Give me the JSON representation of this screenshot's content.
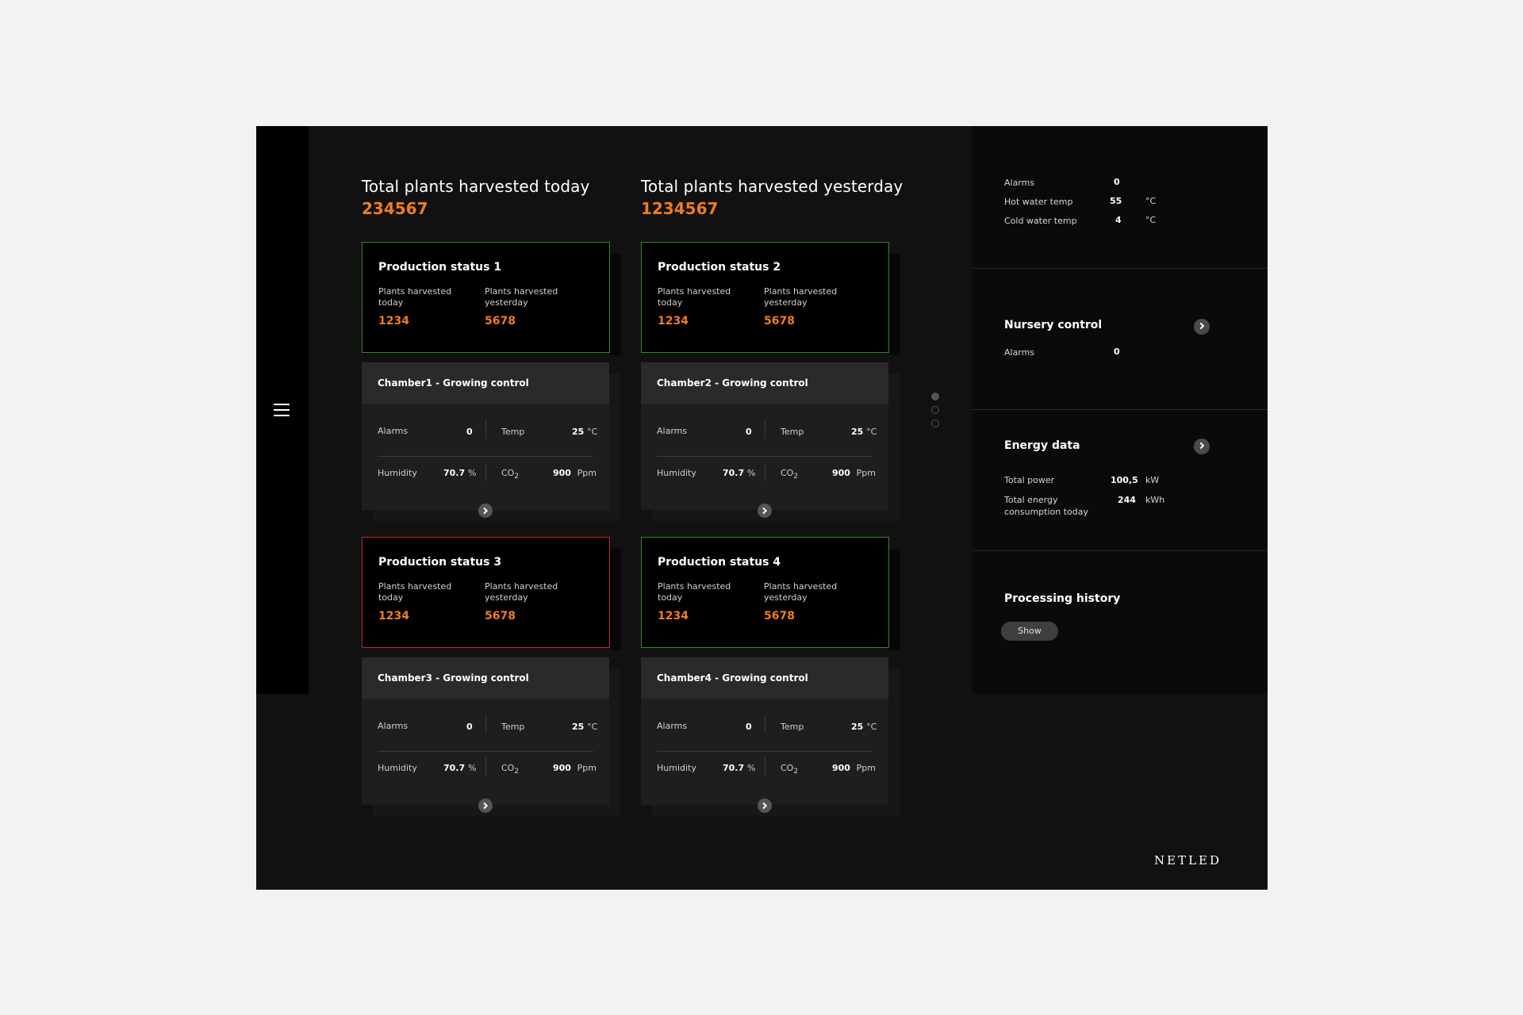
{
  "menu": {
    "icon": "hamburger-icon"
  },
  "totals": [
    {
      "label": "Total plants harvested today",
      "value": "234567"
    },
    {
      "label": "Total plants harvested yesterday",
      "value": "1234567"
    }
  ],
  "production": [
    {
      "title": "Production status 1",
      "today_label": "Plants harvested today",
      "yesterday_label": "Plants harvested yesterday",
      "today": "1234",
      "yesterday": "5678",
      "status_color": "#2f8a24"
    },
    {
      "title": "Production status 2",
      "today_label": "Plants harvested today",
      "yesterday_label": "Plants harvested yesterday",
      "today": "1234",
      "yesterday": "5678",
      "status_color": "#2f8a24"
    },
    {
      "title": "Production status 3",
      "today_label": "Plants harvested today",
      "yesterday_label": "Plants harvested yesterday",
      "today": "1234",
      "yesterday": "5678",
      "status_color": "#c2272d"
    },
    {
      "title": "Production status 4",
      "today_label": "Plants harvested today",
      "yesterday_label": "Plants harvested yesterday",
      "today": "1234",
      "yesterday": "5678",
      "status_color": "#2f8a24"
    }
  ],
  "chambers": [
    {
      "title": "Chamber1 - Growing control",
      "alarms_label": "Alarms",
      "alarms": "0",
      "temp_label": "Temp",
      "temp": "25",
      "temp_unit": "°C",
      "humidity_label": "Humidity",
      "humidity": "70.7",
      "humidity_unit": "%",
      "co2_label": "CO",
      "co2_sub": "2",
      "co2": "900",
      "co2_unit": "Ppm"
    },
    {
      "title": "Chamber2 - Growing control",
      "alarms_label": "Alarms",
      "alarms": "0",
      "temp_label": "Temp",
      "temp": "25",
      "temp_unit": "°C",
      "humidity_label": "Humidity",
      "humidity": "70.7",
      "humidity_unit": "%",
      "co2_label": "CO",
      "co2_sub": "2",
      "co2": "900",
      "co2_unit": "Ppm"
    },
    {
      "title": "Chamber3 - Growing control",
      "alarms_label": "Alarms",
      "alarms": "0",
      "temp_label": "Temp",
      "temp": "25",
      "temp_unit": "°C",
      "humidity_label": "Humidity",
      "humidity": "70.7",
      "humidity_unit": "%",
      "co2_label": "CO",
      "co2_sub": "2",
      "co2": "900",
      "co2_unit": "Ppm"
    },
    {
      "title": "Chamber4 - Growing control",
      "alarms_label": "Alarms",
      "alarms": "0",
      "temp_label": "Temp",
      "temp": "25",
      "temp_unit": "°C",
      "humidity_label": "Humidity",
      "humidity": "70.7",
      "humidity_unit": "%",
      "co2_label": "CO",
      "co2_sub": "2",
      "co2": "900",
      "co2_unit": "Ppm"
    }
  ],
  "pager": {
    "pages": 3,
    "active": 1
  },
  "right": {
    "summary": {
      "alarms_label": "Alarms",
      "alarms": "0",
      "hot_label": "Hot water temp",
      "hot": "55",
      "hot_unit": "°C",
      "cold_label": "Cold water temp",
      "cold": "4",
      "cold_unit": "°C"
    },
    "nursery": {
      "title": "Nursery control",
      "alarms_label": "Alarms",
      "alarms": "0"
    },
    "energy": {
      "title": "Energy data",
      "power_label": "Total power",
      "power": "100,5",
      "power_unit": "kW",
      "consumption_label": "Total energy consumption today",
      "consumption": "244",
      "consumption_unit": "kWh"
    },
    "history": {
      "title": "Processing history",
      "button": "Show"
    }
  },
  "brand": {
    "logo": "NETLED"
  },
  "colors": {
    "accent": "#f07c1e",
    "ok": "#2f8a24",
    "alert": "#c2272d",
    "background": "#111111"
  }
}
